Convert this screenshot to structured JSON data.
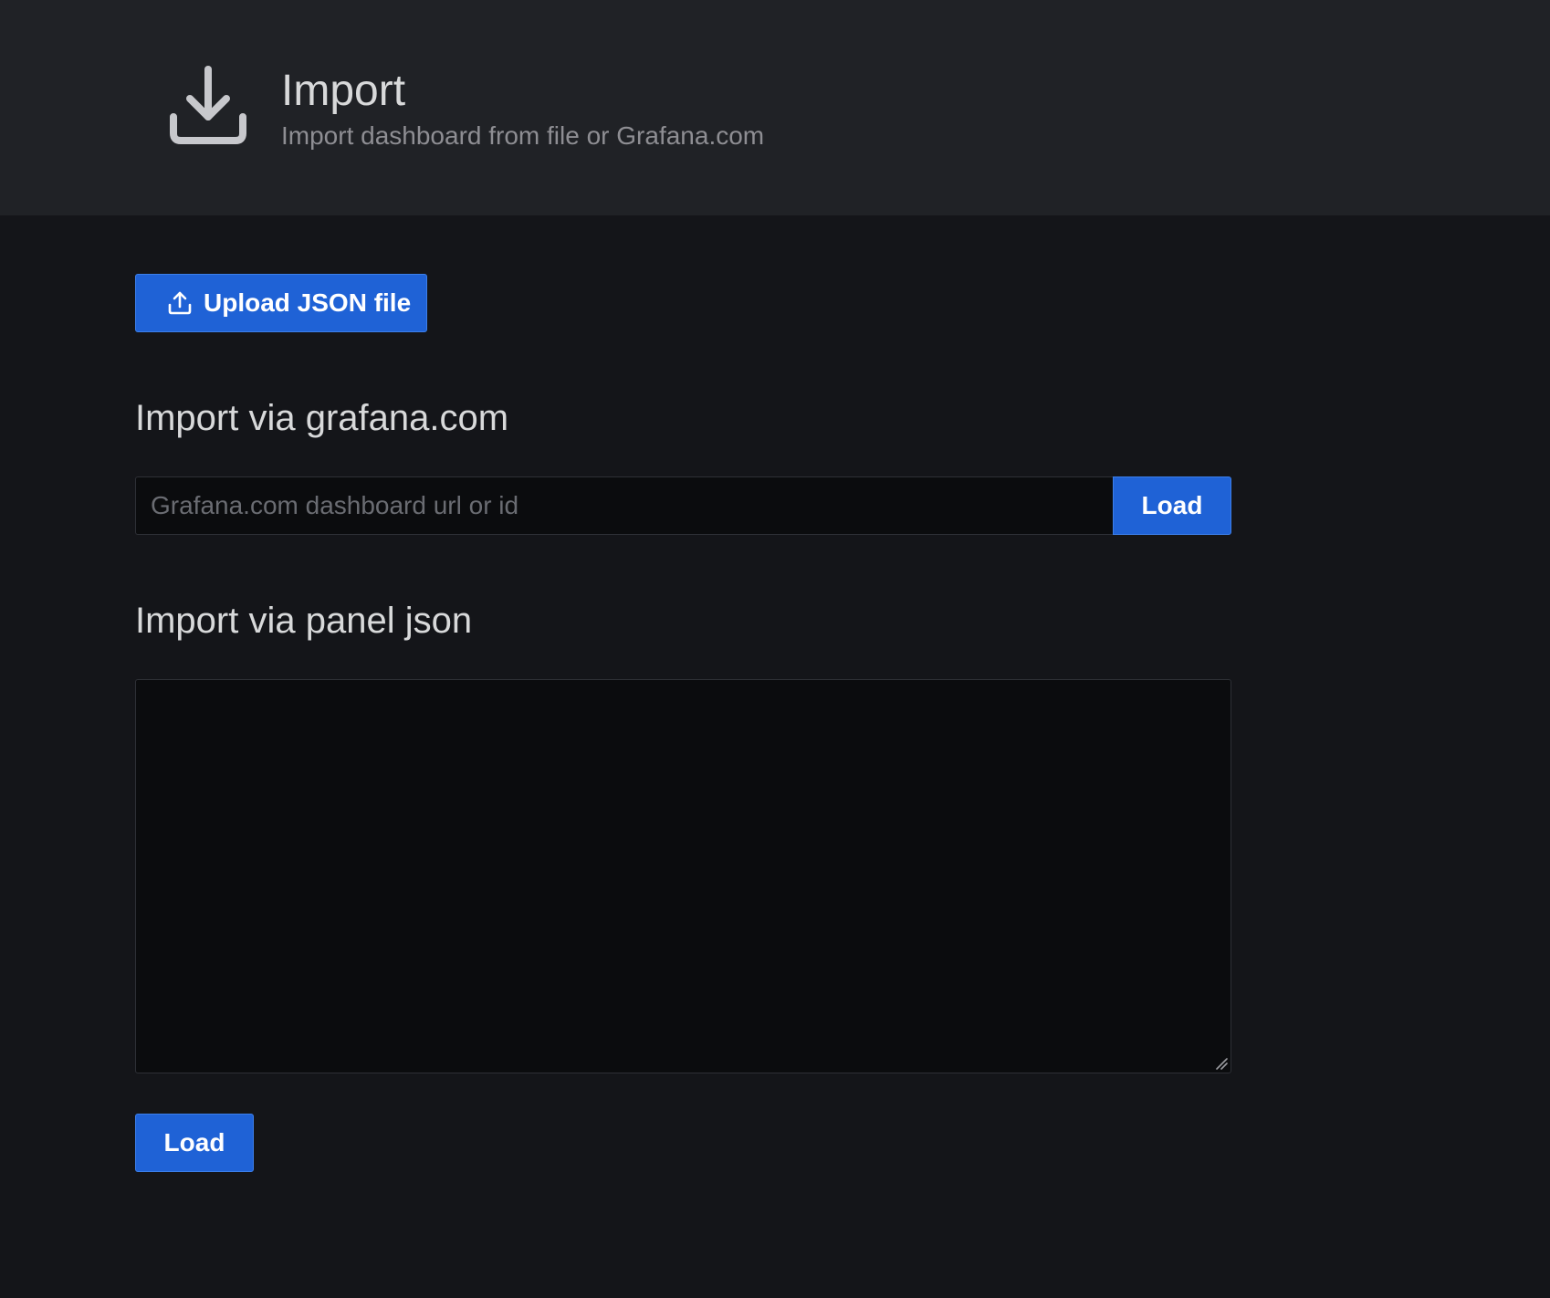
{
  "header": {
    "icon": "download-icon",
    "title": "Import",
    "subtitle": "Import dashboard from file or Grafana.com"
  },
  "upload": {
    "icon": "upload-icon",
    "label": "Upload JSON file"
  },
  "grafana_com": {
    "title": "Import via grafana.com",
    "input_value": "",
    "placeholder": "Grafana.com dashboard url or id",
    "load_label": "Load"
  },
  "panel_json": {
    "title": "Import via panel json",
    "textarea_value": "",
    "load_label": "Load"
  },
  "colors": {
    "primary_button": "#1f62d6",
    "header_bg": "#202226",
    "page_bg": "#141519",
    "input_bg": "#0b0c0e",
    "text_primary": "#d8d9da",
    "text_secondary": "#8e8e93"
  }
}
